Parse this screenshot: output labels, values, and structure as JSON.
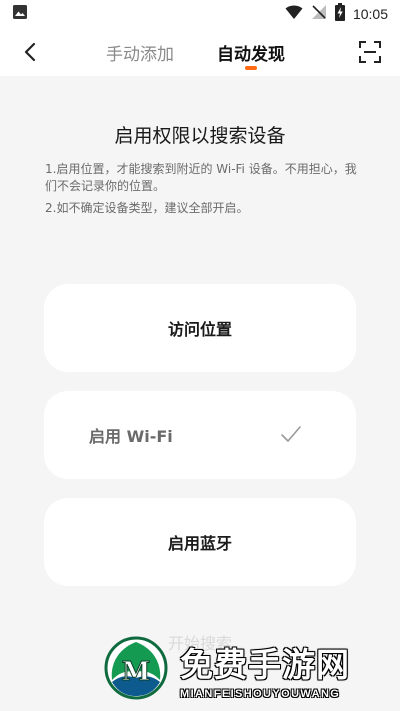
{
  "status_bar": {
    "time": "10:05",
    "icons": [
      "gallery-icon",
      "wifi-icon",
      "no-signal-icon",
      "battery-charging-icon"
    ]
  },
  "header": {
    "tabs": [
      {
        "label": "手动添加",
        "active": false
      },
      {
        "label": "自动发现",
        "active": true
      }
    ],
    "accent_color": "#ff6a13"
  },
  "main": {
    "title": "启用权限以搜索设备",
    "description_1": "1.启用位置，才能搜索到附近的 Wi-Fi 设备。不用担心，我们不会记录你的位置。",
    "description_2": "2.如不确定设备类型，建议全部开启。",
    "cards": [
      {
        "label": "访问位置",
        "enabled": false
      },
      {
        "label": "启用 Wi-Fi",
        "enabled": true
      },
      {
        "label": "启用蓝牙",
        "enabled": false
      }
    ],
    "start_button": "开始搜索"
  },
  "watermark": {
    "title": "免费手游网",
    "subtitle": "MIANFEISHOUYOUWANG",
    "logo_letter": "M"
  }
}
